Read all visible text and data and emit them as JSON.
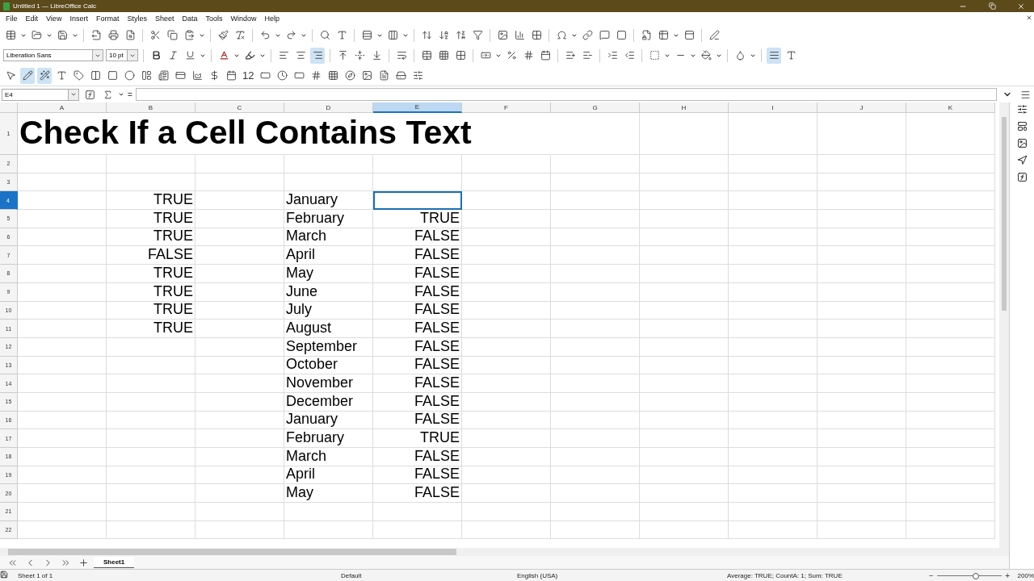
{
  "window": {
    "title": "Untitled 1 — LibreOffice Calc"
  },
  "menu": [
    "File",
    "Edit",
    "View",
    "Insert",
    "Format",
    "Styles",
    "Sheet",
    "Data",
    "Tools",
    "Window",
    "Help"
  ],
  "formatting": {
    "font_name": "Liberation Sans",
    "font_size": "10 pt"
  },
  "drawing_toolbar": {
    "number_format_label": "12"
  },
  "formula_bar": {
    "name_box": "E4",
    "equals": "="
  },
  "columns": [
    {
      "label": "A",
      "selected": false
    },
    {
      "label": "B",
      "selected": false
    },
    {
      "label": "C",
      "selected": false
    },
    {
      "label": "D",
      "selected": false
    },
    {
      "label": "E",
      "selected": true
    },
    {
      "label": "F",
      "selected": false
    },
    {
      "label": "G",
      "selected": false
    },
    {
      "label": "H",
      "selected": false
    },
    {
      "label": "I",
      "selected": false
    },
    {
      "label": "J",
      "selected": false
    },
    {
      "label": "K",
      "selected": false
    }
  ],
  "rows": [
    {
      "label": "1",
      "selected": false,
      "cells": [
        {
          "text": "Check If a Cell Contains Text",
          "kind": "title"
        }
      ]
    },
    {
      "label": "2",
      "selected": false,
      "cells": []
    },
    {
      "label": "3",
      "selected": false,
      "cells": []
    },
    {
      "label": "4",
      "selected": true,
      "cells": [
        null,
        {
          "text": "TRUE",
          "kind": "boolean"
        },
        null,
        {
          "text": "January",
          "kind": "text"
        }
      ]
    },
    {
      "label": "5",
      "selected": false,
      "cells": [
        null,
        {
          "text": "TRUE",
          "kind": "boolean"
        },
        null,
        {
          "text": "February",
          "kind": "text"
        },
        {
          "text": "TRUE",
          "kind": "boolean"
        }
      ]
    },
    {
      "label": "6",
      "selected": false,
      "cells": [
        null,
        {
          "text": "TRUE",
          "kind": "boolean"
        },
        null,
        {
          "text": "March",
          "kind": "text"
        },
        {
          "text": "FALSE",
          "kind": "boolean"
        }
      ]
    },
    {
      "label": "7",
      "selected": false,
      "cells": [
        null,
        {
          "text": "FALSE",
          "kind": "boolean"
        },
        null,
        {
          "text": "April",
          "kind": "text"
        },
        {
          "text": "FALSE",
          "kind": "boolean"
        }
      ]
    },
    {
      "label": "8",
      "selected": false,
      "cells": [
        null,
        {
          "text": "TRUE",
          "kind": "boolean"
        },
        null,
        {
          "text": "May",
          "kind": "text"
        },
        {
          "text": "FALSE",
          "kind": "boolean"
        }
      ]
    },
    {
      "label": "9",
      "selected": false,
      "cells": [
        null,
        {
          "text": "TRUE",
          "kind": "boolean"
        },
        null,
        {
          "text": "June",
          "kind": "text"
        },
        {
          "text": "FALSE",
          "kind": "boolean"
        }
      ]
    },
    {
      "label": "10",
      "selected": false,
      "cells": [
        null,
        {
          "text": "TRUE",
          "kind": "boolean"
        },
        null,
        {
          "text": "July",
          "kind": "text"
        },
        {
          "text": "FALSE",
          "kind": "boolean"
        }
      ]
    },
    {
      "label": "11",
      "selected": false,
      "cells": [
        null,
        {
          "text": "TRUE",
          "kind": "boolean"
        },
        null,
        {
          "text": "August",
          "kind": "text"
        },
        {
          "text": "FALSE",
          "kind": "boolean"
        }
      ]
    },
    {
      "label": "12",
      "selected": false,
      "cells": [
        null,
        null,
        null,
        {
          "text": "September",
          "kind": "text"
        },
        {
          "text": "FALSE",
          "kind": "boolean"
        }
      ]
    },
    {
      "label": "13",
      "selected": false,
      "cells": [
        null,
        null,
        null,
        {
          "text": "October",
          "kind": "text"
        },
        {
          "text": "FALSE",
          "kind": "boolean"
        }
      ]
    },
    {
      "label": "14",
      "selected": false,
      "cells": [
        null,
        null,
        null,
        {
          "text": "November",
          "kind": "text"
        },
        {
          "text": "FALSE",
          "kind": "boolean"
        }
      ]
    },
    {
      "label": "15",
      "selected": false,
      "cells": [
        null,
        null,
        null,
        {
          "text": "December",
          "kind": "text"
        },
        {
          "text": "FALSE",
          "kind": "boolean"
        }
      ]
    },
    {
      "label": "16",
      "selected": false,
      "cells": [
        null,
        null,
        null,
        {
          "text": "January",
          "kind": "text"
        },
        {
          "text": "FALSE",
          "kind": "boolean"
        }
      ]
    },
    {
      "label": "17",
      "selected": false,
      "cells": [
        null,
        null,
        null,
        {
          "text": "February",
          "kind": "text"
        },
        {
          "text": "TRUE",
          "kind": "boolean"
        }
      ]
    },
    {
      "label": "18",
      "selected": false,
      "cells": [
        null,
        null,
        null,
        {
          "text": "March",
          "kind": "text"
        },
        {
          "text": "FALSE",
          "kind": "boolean"
        }
      ]
    },
    {
      "label": "19",
      "selected": false,
      "cells": [
        null,
        null,
        null,
        {
          "text": "April",
          "kind": "text"
        },
        {
          "text": "FALSE",
          "kind": "boolean"
        }
      ]
    },
    {
      "label": "20",
      "selected": false,
      "cells": [
        null,
        null,
        null,
        {
          "text": "May",
          "kind": "text"
        },
        {
          "text": "FALSE",
          "kind": "boolean"
        }
      ]
    },
    {
      "label": "21",
      "selected": false,
      "cells": []
    },
    {
      "label": "22",
      "selected": false,
      "cells": []
    }
  ],
  "sheet_tabs": [
    {
      "label": "Sheet1",
      "selected": true
    }
  ],
  "status_bar": {
    "sheet": "Sheet 1 of 1",
    "page_style": "Default",
    "language": "English (USA)",
    "summary": "Average: TRUE; CountA: 1; Sum: TRUE",
    "zoom_minus": "−",
    "zoom_plus": "+",
    "zoom_slider": {
      "level": 0.6
    },
    "zoom": "200%"
  }
}
